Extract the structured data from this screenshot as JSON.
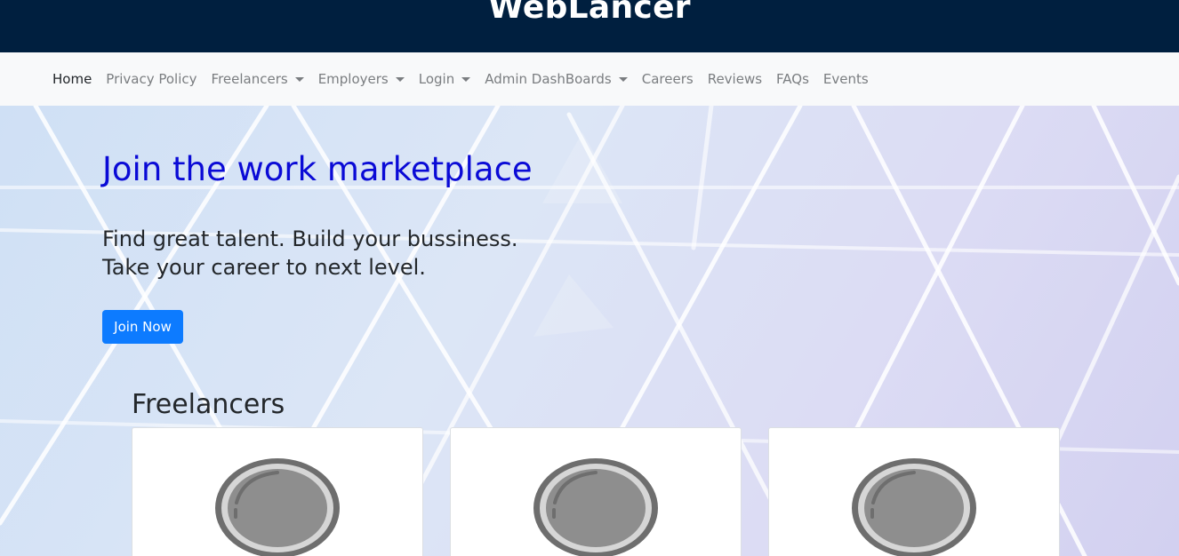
{
  "site": {
    "title": "WebLancer"
  },
  "nav": {
    "items": [
      {
        "label": "Home",
        "active": true,
        "dropdown": false
      },
      {
        "label": "Privacy Policy",
        "active": false,
        "dropdown": false
      },
      {
        "label": "Freelancers",
        "active": false,
        "dropdown": true
      },
      {
        "label": "Employers",
        "active": false,
        "dropdown": true
      },
      {
        "label": "Login",
        "active": false,
        "dropdown": true
      },
      {
        "label": "Admin DashBoards",
        "active": false,
        "dropdown": true
      },
      {
        "label": "Careers",
        "active": false,
        "dropdown": false
      },
      {
        "label": "Reviews",
        "active": false,
        "dropdown": false
      },
      {
        "label": "FAQs",
        "active": false,
        "dropdown": false
      },
      {
        "label": "Events",
        "active": false,
        "dropdown": false
      }
    ]
  },
  "hero": {
    "heading": "Join the work marketplace",
    "subtitle_line1": "Find great talent. Build your bussiness.",
    "subtitle_line2": "Take your career to next level.",
    "cta_label": "Join Now"
  },
  "freelancers": {
    "title": "Freelancers",
    "cards": [
      {
        "icon": "avatar-placeholder-icon"
      },
      {
        "icon": "avatar-placeholder-icon"
      },
      {
        "icon": "avatar-placeholder-icon"
      }
    ]
  },
  "colors": {
    "topbar": "#001f3f",
    "navbar": "#f8f9fa",
    "heading": "#0a0ad6",
    "button": "#0d7bff"
  }
}
